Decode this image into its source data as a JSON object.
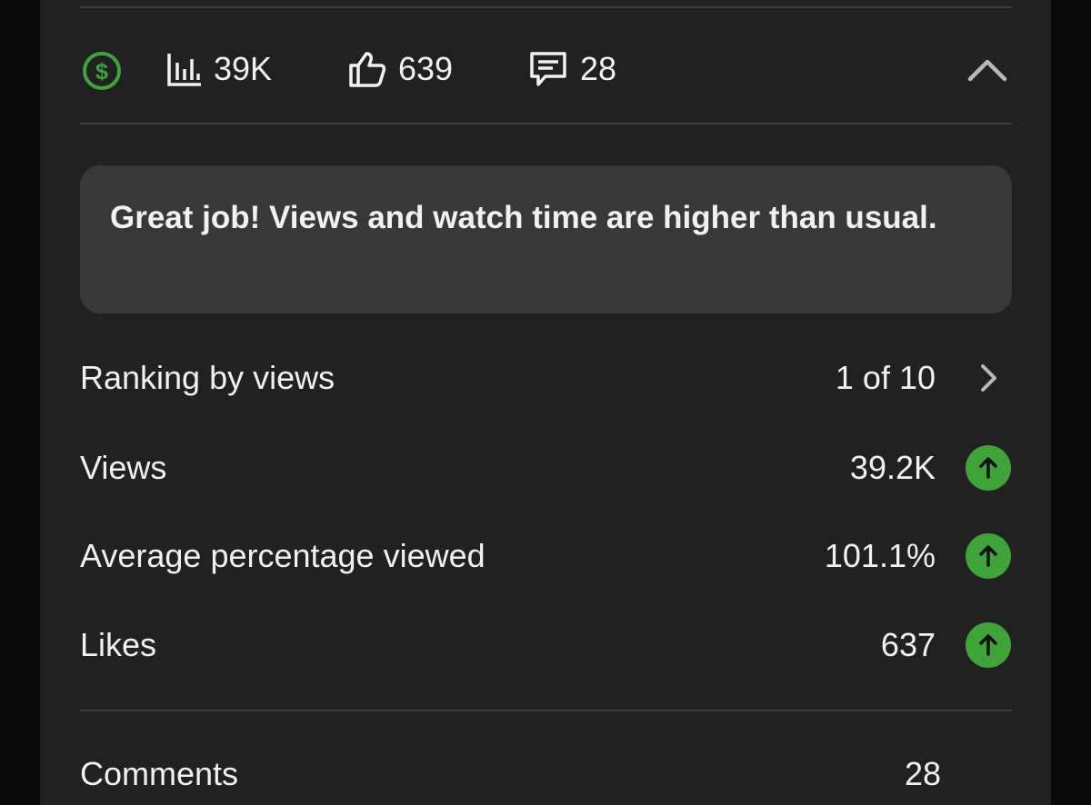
{
  "stats_bar": {
    "views": "39K",
    "likes": "639",
    "comments": "28"
  },
  "banner": {
    "message": "Great job! Views and watch time are higher than usual."
  },
  "metrics": [
    {
      "label": "Ranking by views",
      "value": "1 of 10",
      "indicator": "chevron-right-icon"
    },
    {
      "label": "Views",
      "value": "39.2K",
      "indicator": "arrow-up-icon"
    },
    {
      "label": "Average percentage viewed",
      "value": "101.1%",
      "indicator": "arrow-up-icon"
    },
    {
      "label": "Likes",
      "value": "637",
      "indicator": "arrow-up-icon"
    }
  ],
  "comments_row": {
    "label": "Comments",
    "value": "28"
  },
  "colors": {
    "background": "#0a0a0a",
    "card": "#212121",
    "banner": "#383838",
    "text": "#f1f1f1",
    "accent_green": "#3fa33a",
    "divider": "#3d3d3d"
  }
}
